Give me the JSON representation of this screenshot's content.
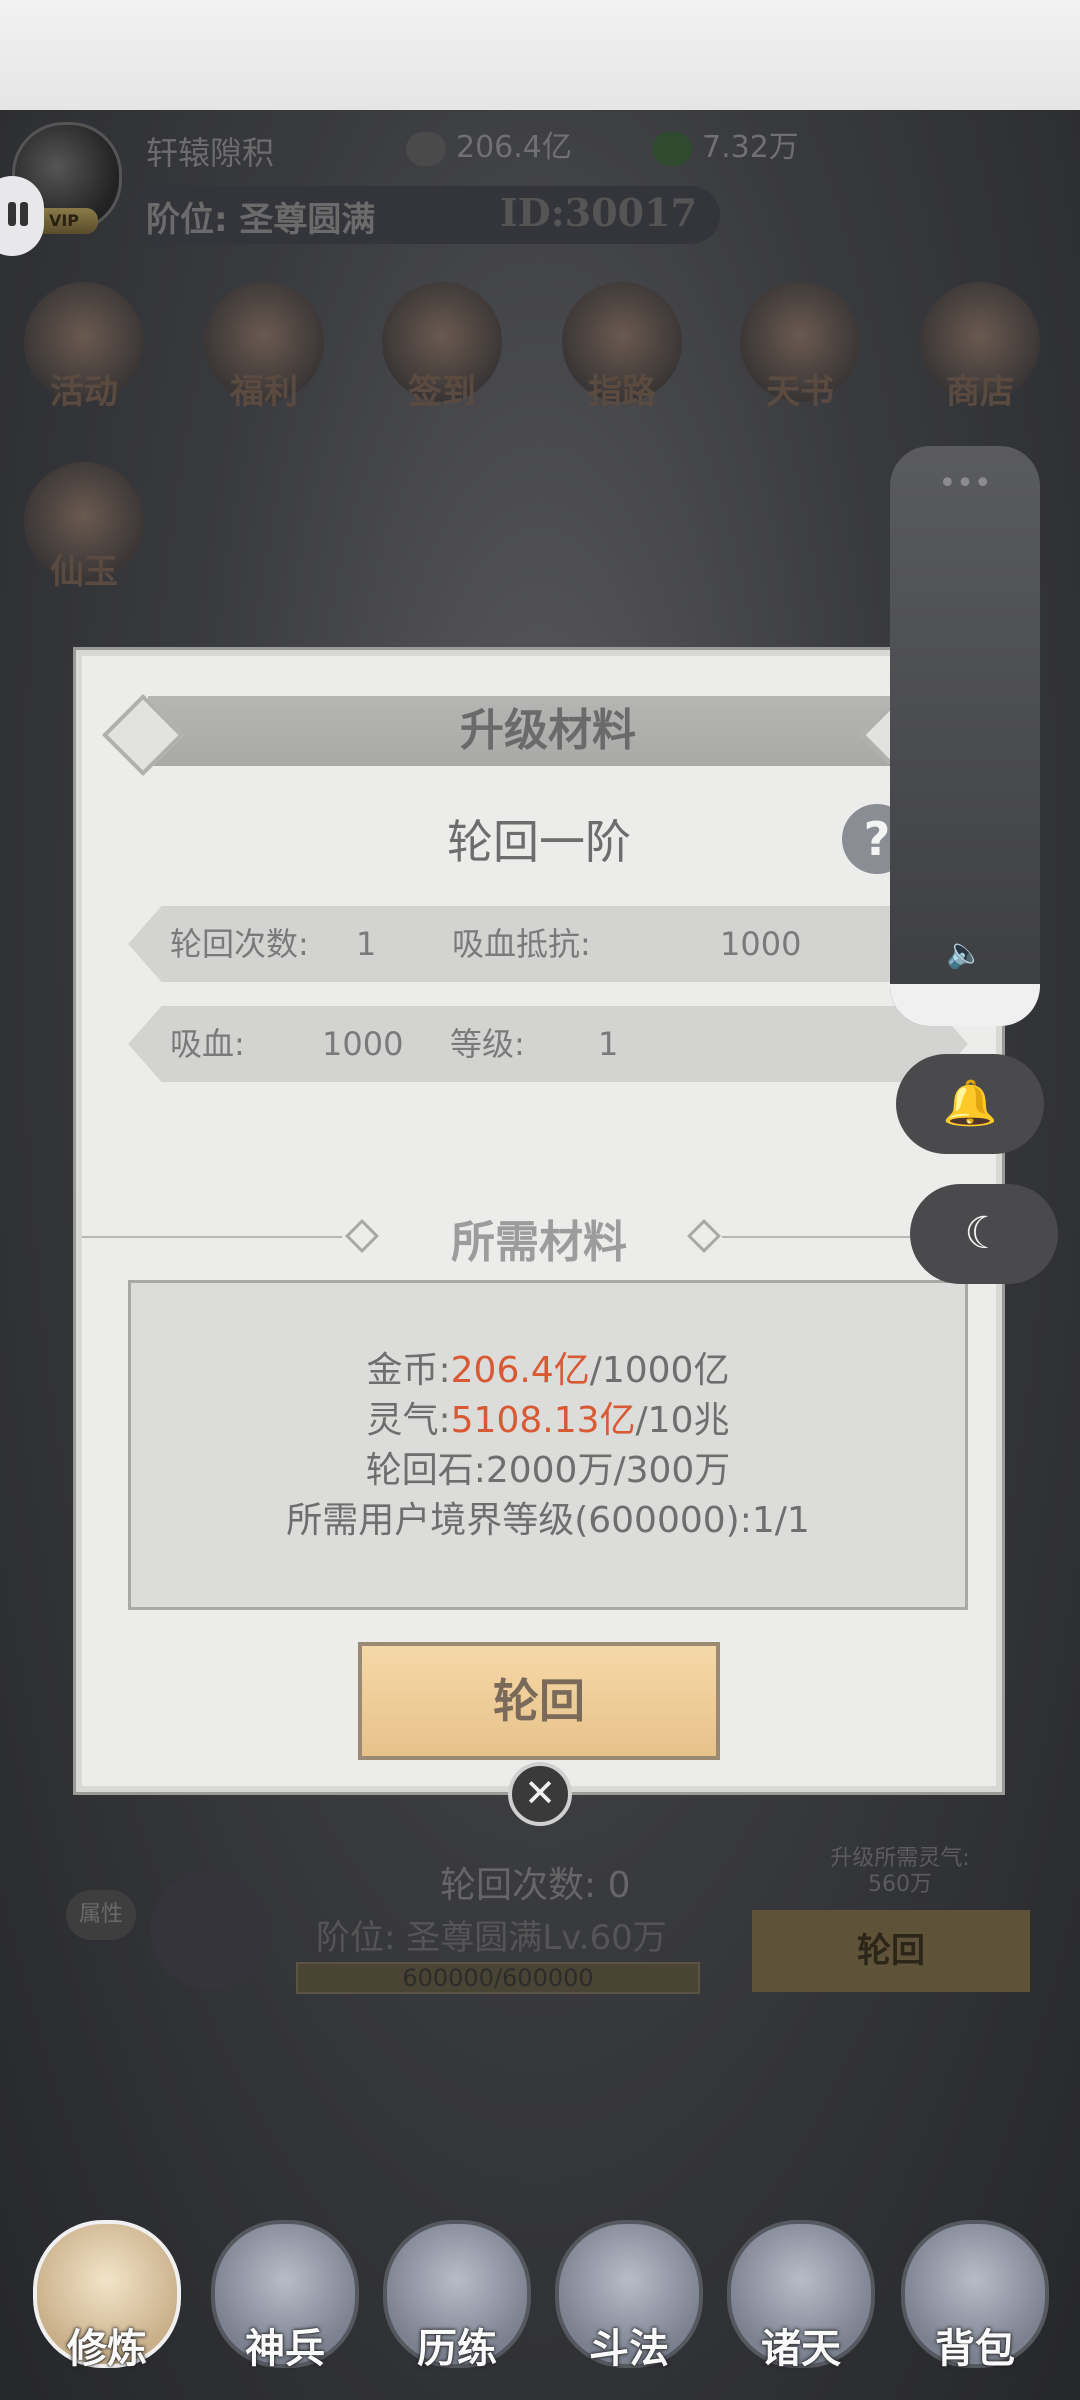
{
  "header": {
    "player_name": "轩辕隙积",
    "vip_label": "VIP",
    "coins": "206.4亿",
    "jade": "7.32万",
    "rank_label": "阶位: 圣尊圆满",
    "player_id": "ID:30017"
  },
  "top_icons": [
    "活动",
    "福利",
    "签到",
    "指路",
    "天书",
    "商店",
    "仙玉"
  ],
  "dialog": {
    "title": "升级材料",
    "subtitle": "轮回一阶",
    "help": "?",
    "stats_row1": {
      "label1": "轮回次数:",
      "value1": "1",
      "label2": "吸血抵抗:",
      "value2": "1000"
    },
    "stats_row2": {
      "label1": "吸血:",
      "value1": "1000",
      "label2": "等级:",
      "value2": "1"
    },
    "section_title": "所需材料",
    "materials": [
      {
        "label": "金币:",
        "have": "206.4亿",
        "need": "/1000亿"
      },
      {
        "label": "灵气:",
        "have": "5108.13亿",
        "need": "/10兆"
      },
      {
        "label": "轮回石:",
        "have": "2000万",
        "need": "/300万"
      },
      {
        "label": "所需用户境界等级(600000):",
        "have": "1",
        "need": "/1"
      }
    ],
    "confirm_button": "轮回",
    "close": "✕"
  },
  "side_panel": {
    "dots": "•••",
    "speaker": "🔈",
    "bell": "🔔",
    "moon": "☾"
  },
  "bottom_info": {
    "attr_label": "属性",
    "reincarnation_count": "轮回次数: 0",
    "rank": "阶位: 圣尊圆满Lv.60万",
    "progress": "600000/600000",
    "need_label": "升级所需灵气:",
    "need_value": "560万",
    "button": "轮回"
  },
  "nav": [
    "修炼",
    "神兵",
    "历练",
    "斗法",
    "诸天",
    "背包"
  ],
  "nav_active_index": 0
}
